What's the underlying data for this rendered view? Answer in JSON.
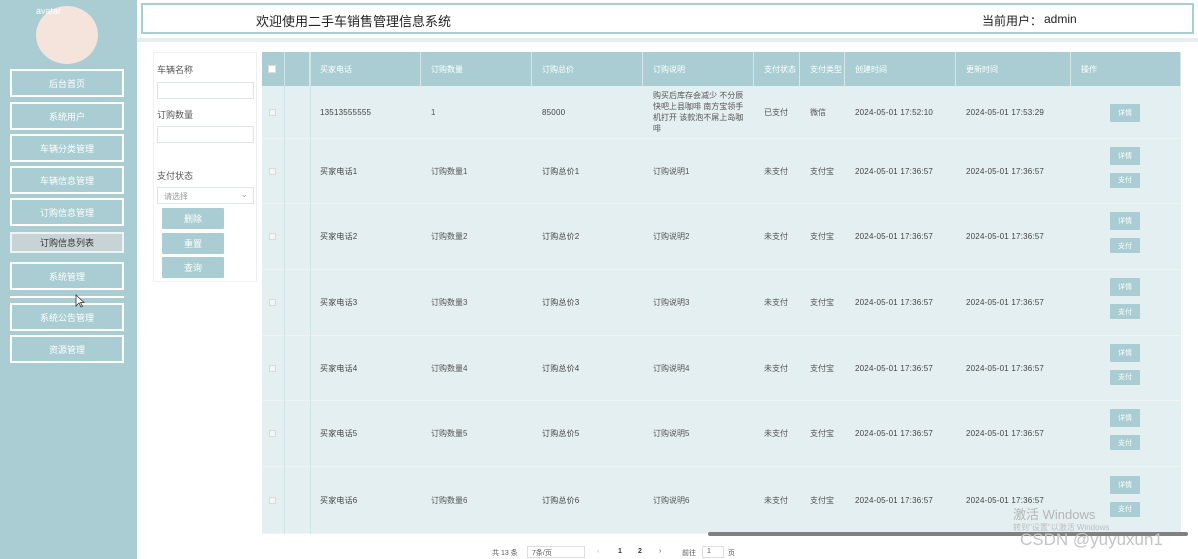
{
  "app": {
    "title": "欢迎使用二手车销售管理信息系统",
    "current_user_label": "当前用户：",
    "current_user": "admin",
    "avatar_alt": "avatar"
  },
  "sidebar": {
    "items": [
      {
        "label": "后台首页"
      },
      {
        "label": "系统用户"
      },
      {
        "label": "车辆分类管理"
      },
      {
        "label": "车辆信息管理"
      },
      {
        "label": "订购信息管理"
      },
      {
        "label": "订购信息列表",
        "active": true
      },
      {
        "label": "系统管理"
      },
      {
        "label": "系统公告管理"
      },
      {
        "label": "资源管理"
      }
    ]
  },
  "search": {
    "vehicle_name_label": "车辆名称",
    "order_qty_label": "订购数量",
    "pay_status_label": "支付状态",
    "pay_status_placeholder": "请选择",
    "delete_label": "删除",
    "reset_label": "重置",
    "query_label": "查询"
  },
  "table": {
    "headers": [
      "买家电话",
      "订购数量",
      "订购总价",
      "订购说明",
      "支付状态",
      "支付类型",
      "创建时间",
      "更新时间",
      "操作"
    ],
    "detail_label": "详情",
    "pay_label": "支付",
    "rows": [
      {
        "phone": "13513555555",
        "qty": "1",
        "total": "85000",
        "desc": "购买后库存会减少 不分辰快吧上县咖啡 南方宝领手机打开 该款泡不屌上岛咖啡",
        "status": "已支付",
        "type": "微信",
        "created": "2024-05-01 17:52:10",
        "updated": "2024-05-01 17:53:29",
        "pay_btn": false
      },
      {
        "phone": "买家电话1",
        "qty": "订购数量1",
        "total": "订购总价1",
        "desc": "订购说明1",
        "status": "未支付",
        "type": "支付宝",
        "created": "2024-05-01 17:36:57",
        "updated": "2024-05-01 17:36:57",
        "pay_btn": true
      },
      {
        "phone": "买家电话2",
        "qty": "订购数量2",
        "total": "订购总价2",
        "desc": "订购说明2",
        "status": "未支付",
        "type": "支付宝",
        "created": "2024-05-01 17:36:57",
        "updated": "2024-05-01 17:36:57",
        "pay_btn": true
      },
      {
        "phone": "买家电话3",
        "qty": "订购数量3",
        "total": "订购总价3",
        "desc": "订购说明3",
        "status": "未支付",
        "type": "支付宝",
        "created": "2024-05-01 17:36:57",
        "updated": "2024-05-01 17:36:57",
        "pay_btn": true
      },
      {
        "phone": "买家电话4",
        "qty": "订购数量4",
        "total": "订购总价4",
        "desc": "订购说明4",
        "status": "未支付",
        "type": "支付宝",
        "created": "2024-05-01 17:36:57",
        "updated": "2024-05-01 17:36:57",
        "pay_btn": true
      },
      {
        "phone": "买家电话5",
        "qty": "订购数量5",
        "total": "订购总价5",
        "desc": "订购说明5",
        "status": "未支付",
        "type": "支付宝",
        "created": "2024-05-01 17:36:57",
        "updated": "2024-05-01 17:36:57",
        "pay_btn": true
      },
      {
        "phone": "买家电话6",
        "qty": "订购数量6",
        "total": "订购总价6",
        "desc": "订购说明6",
        "status": "未支付",
        "type": "支付宝",
        "created": "2024-05-01 17:36:57",
        "updated": "2024-05-01 17:36:57",
        "pay_btn": true
      }
    ]
  },
  "pagination": {
    "total_text": "共 13 条",
    "page_size": "7条/页",
    "prev": "‹",
    "pages": [
      "1",
      "2"
    ],
    "next": "›",
    "goto_label": "前往",
    "goto_value": "1",
    "page_unit": "页"
  },
  "watermark": {
    "line1": "激活 Windows",
    "line2": "转到\"设置\"以激活 Windows",
    "line3": "CSDN @yuyuxun1"
  }
}
